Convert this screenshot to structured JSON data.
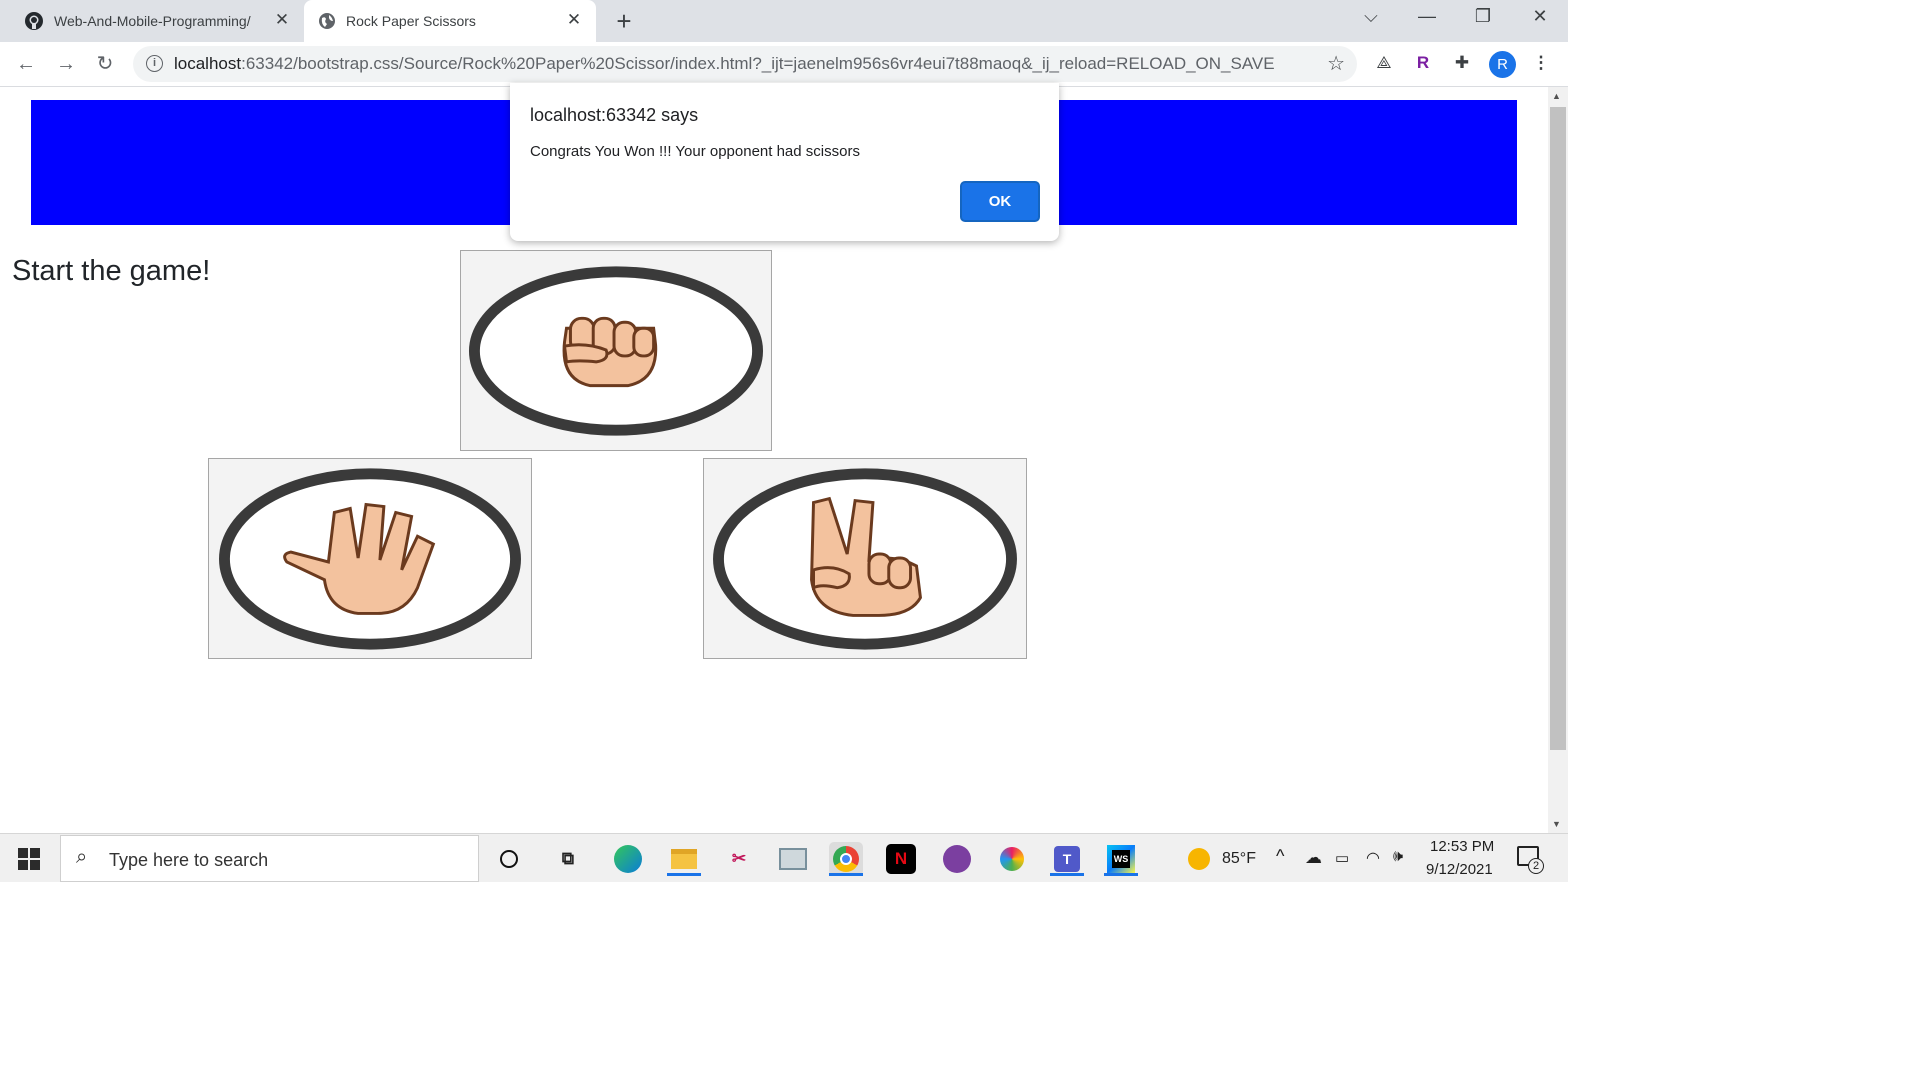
{
  "browser": {
    "tabs": [
      {
        "title": "Web-And-Mobile-Programming/",
        "icon": "github-icon",
        "active": false
      },
      {
        "title": "Rock Paper Scissors",
        "icon": "globe-icon",
        "active": true
      }
    ],
    "url": {
      "host": "localhost",
      "path": ":63342/bootstrap.css/Source/Rock%20Paper%20Scissor/index.html?_ijt=jaenelm956s6vr4eui7t88maoq&_ij_reload=RELOAD_ON_SAVE"
    },
    "profile_initial": "R",
    "extensions": [
      "translate-icon",
      "r-extension-icon",
      "puzzle-icon"
    ]
  },
  "page": {
    "banner_color": "#0000ff",
    "start_text": "Start the game!",
    "choices": [
      "rock",
      "paper",
      "scissors"
    ]
  },
  "dialog": {
    "title": "localhost:63342 says",
    "message": "Congrats You Won !!! Your opponent had scissors",
    "ok_label": "OK"
  },
  "taskbar": {
    "search_placeholder": "Type here to search",
    "weather": "85°F",
    "time": "12:53 PM",
    "date": "9/12/2021",
    "notification_count": "2",
    "apps": [
      "cortana-icon",
      "task-view-icon",
      "edge-icon",
      "file-explorer-icon",
      "snipping-icon",
      "photos-icon",
      "chrome-icon",
      "netflix-icon",
      "github-desktop-icon",
      "paint-icon",
      "teams-icon",
      "webstorm-icon"
    ]
  }
}
